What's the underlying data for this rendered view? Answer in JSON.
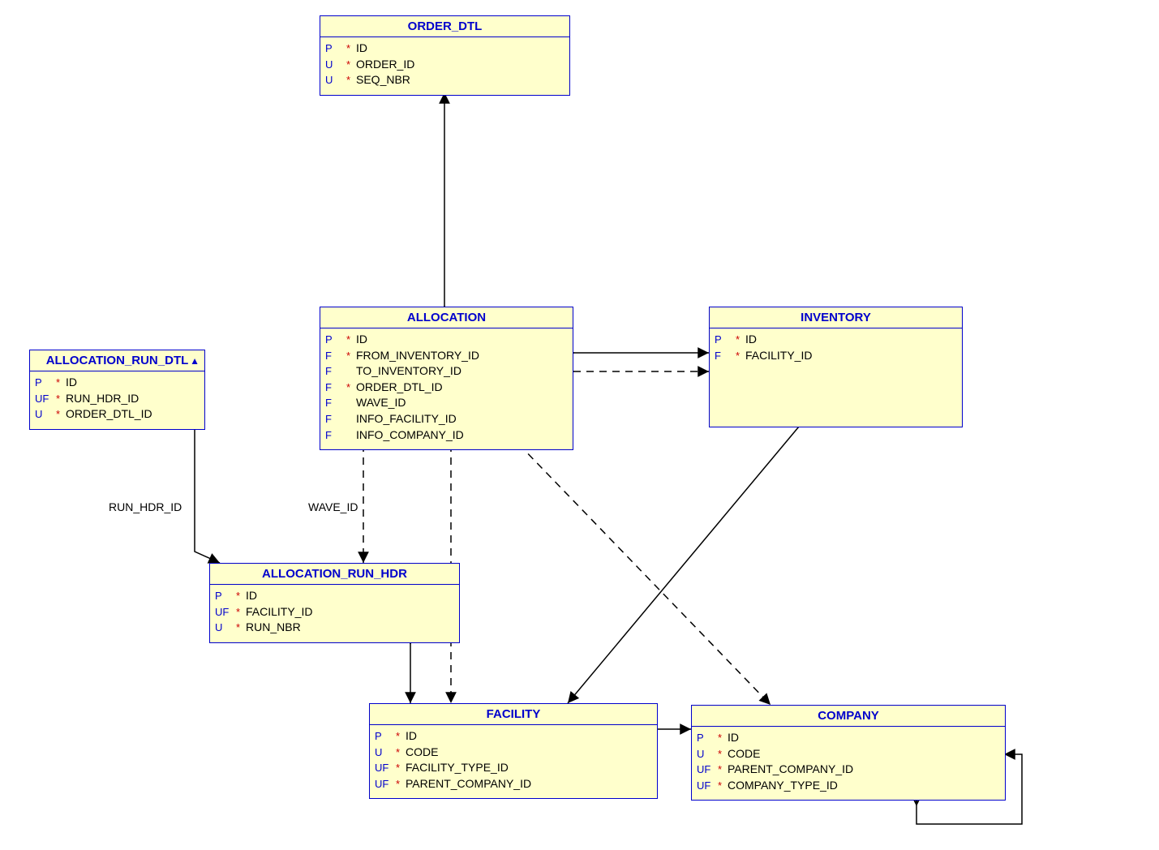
{
  "entities": {
    "order_dtl": {
      "title": "ORDER_DTL",
      "rows": [
        {
          "flag": "P",
          "ast": "*",
          "name": "ID"
        },
        {
          "flag": "U",
          "ast": "*",
          "name": "ORDER_ID"
        },
        {
          "flag": "U",
          "ast": "*",
          "name": "SEQ_NBR"
        }
      ]
    },
    "allocation": {
      "title": "ALLOCATION",
      "rows": [
        {
          "flag": "P",
          "ast": "*",
          "name": "ID"
        },
        {
          "flag": "F",
          "ast": "*",
          "name": "FROM_INVENTORY_ID"
        },
        {
          "flag": "F",
          "ast": "",
          "name": "TO_INVENTORY_ID"
        },
        {
          "flag": "F",
          "ast": "*",
          "name": "ORDER_DTL_ID"
        },
        {
          "flag": "F",
          "ast": "",
          "name": "WAVE_ID"
        },
        {
          "flag": "F",
          "ast": "",
          "name": "INFO_FACILITY_ID"
        },
        {
          "flag": "F",
          "ast": "",
          "name": "INFO_COMPANY_ID"
        }
      ]
    },
    "inventory": {
      "title": "INVENTORY",
      "rows": [
        {
          "flag": "P",
          "ast": "*",
          "name": "ID"
        },
        {
          "flag": "F",
          "ast": "*",
          "name": "FACILITY_ID"
        }
      ]
    },
    "alloc_run_dtl": {
      "title": "ALLOCATION_RUN_DTL",
      "rows": [
        {
          "flag": "P",
          "ast": "*",
          "name": "ID"
        },
        {
          "flag": "UF",
          "ast": "*",
          "name": "RUN_HDR_ID"
        },
        {
          "flag": "U",
          "ast": "*",
          "name": "ORDER_DTL_ID"
        }
      ]
    },
    "alloc_run_hdr": {
      "title": "ALLOCATION_RUN_HDR",
      "rows": [
        {
          "flag": "P",
          "ast": "*",
          "name": "ID"
        },
        {
          "flag": "UF",
          "ast": "*",
          "name": "FACILITY_ID"
        },
        {
          "flag": "U",
          "ast": "*",
          "name": "RUN_NBR"
        }
      ]
    },
    "facility": {
      "title": "FACILITY",
      "rows": [
        {
          "flag": "P",
          "ast": "*",
          "name": "ID"
        },
        {
          "flag": "U",
          "ast": "*",
          "name": "CODE"
        },
        {
          "flag": "UF",
          "ast": "*",
          "name": "FACILITY_TYPE_ID"
        },
        {
          "flag": "UF",
          "ast": "*",
          "name": "PARENT_COMPANY_ID"
        }
      ]
    },
    "company": {
      "title": "COMPANY",
      "rows": [
        {
          "flag": "P",
          "ast": "*",
          "name": "ID"
        },
        {
          "flag": "U",
          "ast": "*",
          "name": "CODE"
        },
        {
          "flag": "UF",
          "ast": "*",
          "name": "PARENT_COMPANY_ID"
        },
        {
          "flag": "UF",
          "ast": "*",
          "name": "COMPANY_TYPE_ID"
        }
      ]
    }
  },
  "labels": {
    "run_hdr_id": "RUN_HDR_ID",
    "wave_id": "WAVE_ID"
  }
}
